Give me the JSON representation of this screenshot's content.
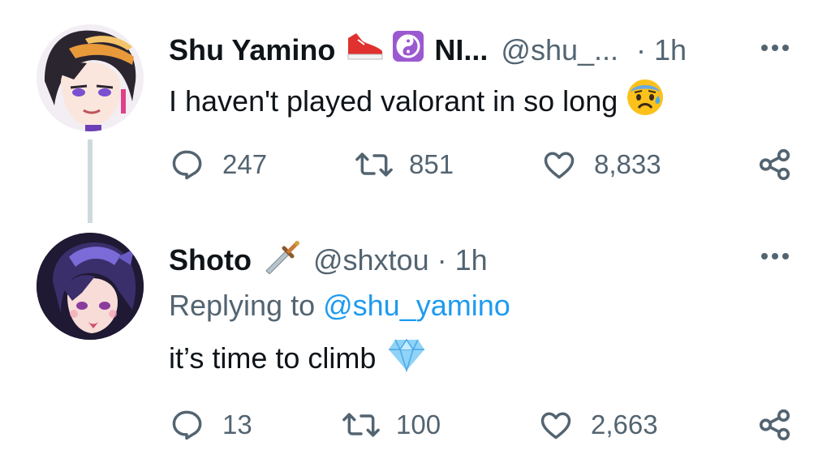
{
  "tweets": [
    {
      "display_name": "Shu Yamino",
      "name_suffix": "NI...",
      "handle": "@shu_...",
      "separator": "·",
      "time": "1h",
      "text": "I haven't played valorant in so long",
      "reply_prefix": "",
      "reply_handle": "",
      "icons": {
        "badge1": "sneaker-emoji",
        "badge2": "yin-yang-emoji",
        "trailing": "anxious-face-emoji"
      },
      "stats": {
        "replies": "247",
        "retweets": "851",
        "likes": "8,833"
      }
    },
    {
      "display_name": "Shoto",
      "name_suffix": "",
      "handle": "@shxtou",
      "separator": "·",
      "time": "1h",
      "text": "it’s time to climb",
      "reply_prefix": "Replying to",
      "reply_handle": "@shu_yamino",
      "icons": {
        "badge1": "dagger-emoji",
        "trailing": "gem-emoji"
      },
      "stats": {
        "replies": "13",
        "retweets": "100",
        "likes": "2,663"
      }
    }
  ],
  "colors": {
    "text": "#0f1419",
    "muted": "#536471",
    "link": "#1d9bf0",
    "thread_line": "#cfd9de"
  }
}
